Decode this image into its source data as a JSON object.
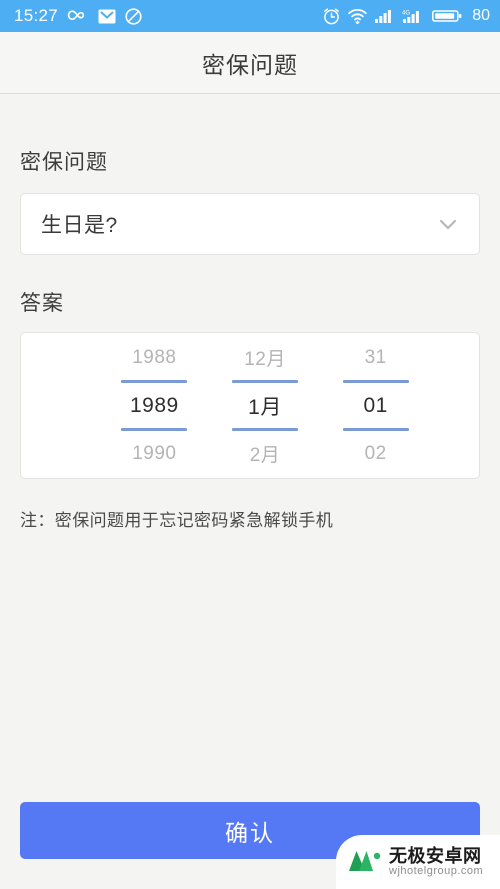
{
  "statusbar": {
    "time": "15:27",
    "battery_level": "80",
    "left_icons": [
      "infinity-icon",
      "mail-icon",
      "do-not-disturb-icon"
    ],
    "right_icons": [
      "alarm-icon",
      "wifi-icon",
      "signal-bars-icon",
      "signal-4g-icon",
      "battery-icon"
    ],
    "network_label": "4G",
    "bar_color": "#4eaef4"
  },
  "header": {
    "title": "密保问题"
  },
  "form": {
    "question_label": "密保问题",
    "question_value": "生日是?",
    "question_dropdown_icon": "chevron-down-icon",
    "answer_label": "答案",
    "note": "注：密保问题用于忘记密码紧急解锁手机"
  },
  "picker": {
    "selected_line_color": "#7a9bd8",
    "columns": [
      {
        "name": "year",
        "prev": "1988",
        "selected": "1989",
        "next": "1990"
      },
      {
        "name": "month",
        "prev": "12月",
        "selected": "1月",
        "next": "2月"
      },
      {
        "name": "day",
        "prev": "31",
        "selected": "01",
        "next": "02"
      }
    ]
  },
  "actions": {
    "confirm_label": "确认",
    "confirm_color": "#5578f5"
  },
  "watermark": {
    "title": "无极安卓网",
    "url": "wjhotelgroup.com",
    "logo_color": "#22a35a"
  }
}
